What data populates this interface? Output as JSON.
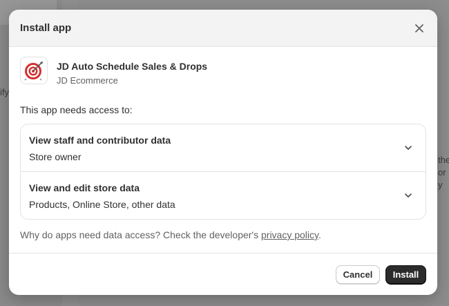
{
  "background": {
    "text_left": "ify",
    "text_right_1": "the",
    "text_right_2": "or y"
  },
  "modal": {
    "title": "Install app",
    "close_icon": "close-icon"
  },
  "app": {
    "name": "JD Auto Schedule Sales & Drops",
    "developer": "JD Ecommerce",
    "icon": "target-icon"
  },
  "access": {
    "heading": "This app needs access to:",
    "items": [
      {
        "title": "View staff and contributor data",
        "description": "Store owner"
      },
      {
        "title": "View and edit store data",
        "description": "Products, Online Store, other data"
      }
    ]
  },
  "footnote": {
    "text": "Why do apps need data access? Check the developer's ",
    "link": "privacy policy",
    "end": "."
  },
  "buttons": {
    "cancel": "Cancel",
    "install": "Install"
  },
  "colors": {
    "primary_button": "#2b2b2b",
    "text": "#303030",
    "muted": "#616161",
    "icon_red": "#d32f2f"
  }
}
